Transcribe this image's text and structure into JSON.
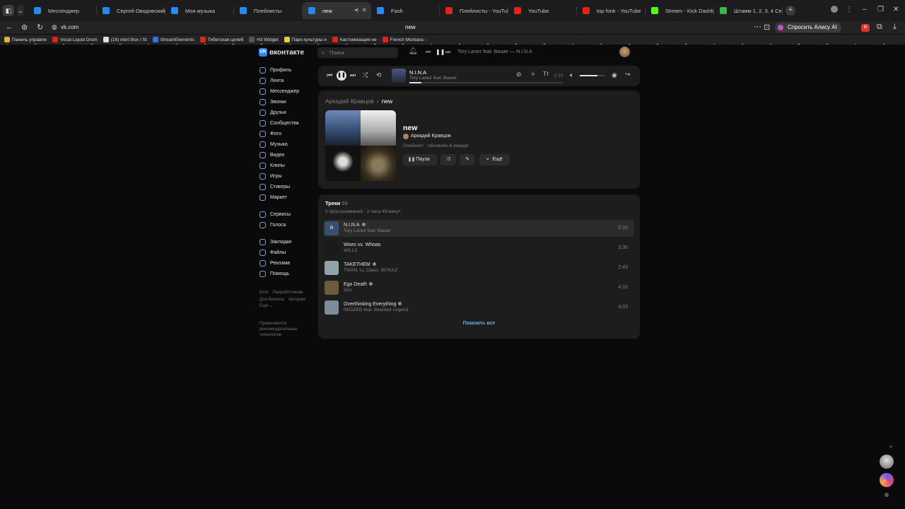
{
  "browser": {
    "tabs": [
      {
        "label": "Мессенджер",
        "color": "#2787f5"
      },
      {
        "label": "Сергей Оводовский",
        "color": "#2787f5"
      },
      {
        "label": "Моя музыка",
        "color": "#2787f5"
      },
      {
        "label": "Плейлисты",
        "color": "#2787f5"
      },
      {
        "label": "new",
        "color": "#2787f5",
        "active": true
      },
      {
        "label": "Fash",
        "color": "#2787f5"
      },
      {
        "label": "Плейлисты - YouTube",
        "color": "#e62117"
      },
      {
        "label": "YouTube",
        "color": "#e62117"
      },
      {
        "label": "top fonk - YouTube",
        "color": "#e62117"
      },
      {
        "label": "Stream - Kick Dashboard",
        "color": "#53fc18"
      },
      {
        "label": "Штамм 1, 2, 3, 4 Сезон Сe",
        "color": "#3bb54a"
      }
    ],
    "url": "vk.com",
    "page_title": "new",
    "alice_label": "Спросить Алису AI",
    "bookmarks": [
      {
        "label": "Панель управле",
        "color": "#e0b13a"
      },
      {
        "label": "Vocal Liquid Drum",
        "color": "#e62117"
      },
      {
        "label": "(16) Alert Box / St",
        "color": "#e0e0e0"
      },
      {
        "label": "StreamElements",
        "color": "#3a6ee8"
      },
      {
        "label": "Тибетская целеб",
        "color": "#e62117"
      },
      {
        "label": "H3 Widget",
        "color": "#555555"
      },
      {
        "label": "Парк культуры и",
        "color": "#e0d040"
      },
      {
        "label": "Кастомизация не",
        "color": "#e62117"
      },
      {
        "label": "French Montana -",
        "color": "#e62117"
      }
    ]
  },
  "vk": {
    "logo": "вконтакте",
    "search_placeholder": "Поиск",
    "header_now_playing": "Tory Lanez feat. Вашег — N.I.N.A",
    "nav": [
      {
        "label": "Профиль"
      },
      {
        "label": "Лента"
      },
      {
        "label": "Мессенджер"
      },
      {
        "label": "Звонки"
      },
      {
        "label": "Друзья"
      },
      {
        "label": "Сообщества"
      },
      {
        "label": "Фото"
      },
      {
        "label": "Музыка"
      },
      {
        "label": "Видео"
      },
      {
        "label": "Клипы"
      },
      {
        "label": "Игры"
      },
      {
        "label": "Стикеры"
      },
      {
        "label": "Маркет"
      },
      {
        "label": "Сервисы",
        "gap": true
      },
      {
        "label": "Голоса"
      },
      {
        "label": "Закладки",
        "gap": true
      },
      {
        "label": "Файлы"
      },
      {
        "label": "Реклама"
      },
      {
        "label": "Помощь"
      }
    ],
    "footer": {
      "links": [
        "Блог",
        "Разработчикам",
        "Для бизнеса",
        "Авторам",
        "Ещё ⌄"
      ],
      "reco_note": "Применяются рекомендательные технологии"
    }
  },
  "player": {
    "title": "N.I.N.A",
    "artist": "Tory Lanez feat. Вашег",
    "time": "0:10",
    "progress": 0.08,
    "volume": 0.7
  },
  "playlist": {
    "breadcrumb_parent": "Аркадий Кравцов",
    "breadcrumb_current": "new",
    "title": "new",
    "owner": "Аркадий Кравцов",
    "meta": "Плейлист · обновлён 6 января",
    "pause_label": "Пауза",
    "more_label": "Ещё"
  },
  "tracks": {
    "heading": "Треки",
    "count": "56",
    "meta": "0 прослушиваний · 2 часа 49 минут",
    "show_all": "Показать все",
    "items": [
      {
        "title": "N.I.N.A",
        "artist": "Tory Lanez feat. Вашег",
        "duration": "0:10",
        "explicit": true,
        "playing": true,
        "thumb": "#3a4e72"
      },
      {
        "title": "Woes vs. Whoas",
        "artist": "WILLS",
        "duration": "3:30",
        "explicit": false,
        "thumb": "#1a1a1a"
      },
      {
        "title": "TAKETHEM",
        "artist": "TWXN, LL Clawz, $07KAZ",
        "duration": "2:43",
        "explicit": true,
        "thumb": "#8fa3a8"
      },
      {
        "title": "Ego Death",
        "artist": "Zeo",
        "duration": "4:10",
        "explicit": true,
        "thumb": "#6b5a3e"
      },
      {
        "title": "Overthinking Everything",
        "artist": "REDZED feat. Bearded Legend",
        "duration": "4:03",
        "explicit": true,
        "thumb": "#7d8c98"
      }
    ]
  }
}
